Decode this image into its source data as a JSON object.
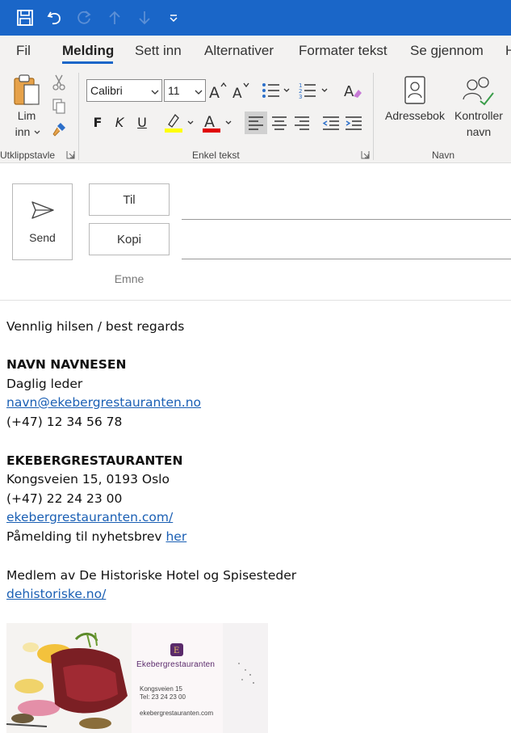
{
  "tabs": [
    "Fil",
    "Melding",
    "Sett inn",
    "Alternativer",
    "Formater tekst",
    "Se gjennom",
    "H"
  ],
  "ribbon": {
    "paste_label_1": "Lim",
    "paste_label_2": "inn",
    "clipboard_group": "Utklippstavle",
    "font_name": "Calibri",
    "font_size": "11",
    "basic_text_group": "Enkel tekst",
    "bold": "F",
    "italic": "K",
    "underline": "U",
    "address_book_label": "Adressebok",
    "check_names_label_1": "Kontroller",
    "check_names_label_2": "navn",
    "names_group": "Navn"
  },
  "compose": {
    "send_label": "Send",
    "to_label": "Til",
    "cc_label": "Kopi",
    "subject_label": "Emne"
  },
  "body": {
    "greeting": "Vennlig hilsen / best regards",
    "name": "NAVN NAVNESEN",
    "title": "Daglig leder",
    "email": "navn@ekebergrestauranten.no",
    "phone": "(+47) 12 34 56 78",
    "company": "EKEBERGRESTAURANTEN",
    "address": "Kongsveien 15, 0193 Oslo",
    "company_phone": "(+47) 22 24 23 00",
    "website": "ekebergrestauranten.com/",
    "newsletter_text": "Påmelding til nyhetsbrev ",
    "newsletter_link": "her",
    "member_text": "Medlem av De Historiske Hotel og Spisesteder",
    "member_link": "dehistoriske.no/"
  },
  "signature_image": {
    "brand": "Ekebergrestauranten",
    "address": "Kongsveien 15",
    "phone": "Tel: 23 24 23 00",
    "website": "ekebergrestauranten.com"
  },
  "colors": {
    "accent": "#1a66c8",
    "highlight": "#ffff00",
    "font_color": "#e00000",
    "link": "#1a5fb4"
  }
}
